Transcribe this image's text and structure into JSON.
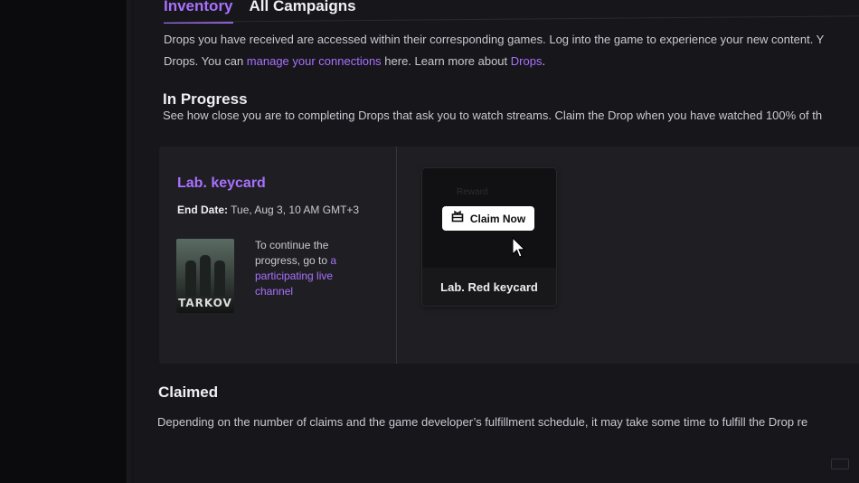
{
  "tabs": [
    {
      "label": "Inventory",
      "active": true
    },
    {
      "label": "All Campaigns",
      "active": false
    }
  ],
  "intro": {
    "line1": "Drops you have received are accessed within their corresponding games. Log into the game to experience your new content. Y",
    "line2_prefix": "Drops. You can ",
    "manage_link": "manage your connections",
    "line2_mid": " here. Learn more about ",
    "drops_link": "Drops",
    "line2_suffix": "."
  },
  "in_progress": {
    "heading": "In Progress",
    "description": "See how close you are to completing Drops that ask you to watch streams. Claim the Drop when you have watched 100% of th"
  },
  "campaign": {
    "title": "Lab. keycard",
    "end_date_label": "End Date:",
    "end_date_value": " Tue, Aug 3, 10 AM GMT+3",
    "game_logo_text": "TARKOV",
    "continue_text": "To continue the progress, go to ",
    "continue_link": "a participating live channel"
  },
  "reward": {
    "ghost_label": "Reward",
    "claim_label": "Claim Now",
    "name": "Lab. Red keycard"
  },
  "claimed": {
    "heading": "Claimed",
    "description": "Depending on the number of claims and the game developer’s fulfillment schedule, it may take some time to fulfill the Drop re"
  },
  "icons": {
    "claim": "gift-box-icon",
    "cursor": "mouse-cursor-icon"
  },
  "colors": {
    "accent": "#a970ff",
    "background": "#17161b",
    "card": "#1f1f23"
  }
}
